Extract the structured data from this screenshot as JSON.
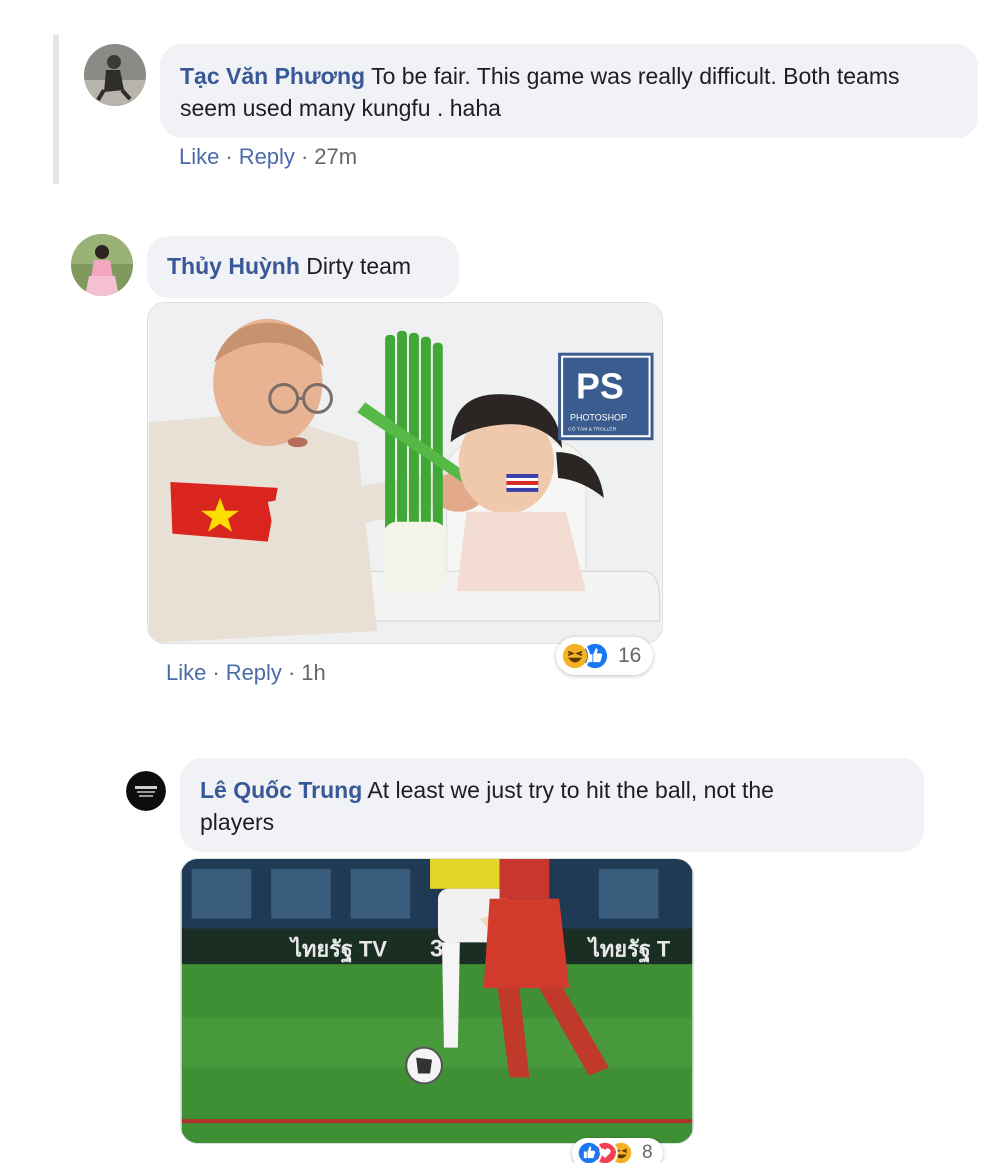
{
  "comments": [
    {
      "author": "Tạc Văn Phương",
      "text": "To be fair. This game was really difficult. Both teams seem used many kungfu . haha",
      "like_label": "Like",
      "reply_label": "Reply",
      "time": "27m"
    },
    {
      "author": "Thủy Huỳnh",
      "text": "Dirty team",
      "like_label": "Like",
      "reply_label": "Reply",
      "time": "1h",
      "image": {
        "watermark_main": "PS",
        "watermark_sub": "PHOTOSHOP",
        "watermark_small": "CÓ TÂM & TROLLER"
      },
      "reactions": {
        "icons": [
          "haha-icon",
          "like-icon"
        ],
        "count": "16"
      }
    },
    {
      "author": "Lê Quốc Trung",
      "text_line1": "At least we just try to hit the ball, not the",
      "text_line2": "players",
      "image": {
        "banner_left": "ไทยรัฐ TV",
        "banner_num": "32",
        "banner_right": "ไทยรัฐ T"
      },
      "reactions": {
        "icons": [
          "like-icon",
          "love-icon",
          "haha-icon"
        ],
        "count": "8"
      }
    }
  ],
  "colors": {
    "author": "#385898",
    "bubble": "#f0f2f5",
    "action": "#4b6aa8",
    "like": "#1877f2",
    "love": "#f33e58",
    "haha": "#f7b125"
  }
}
